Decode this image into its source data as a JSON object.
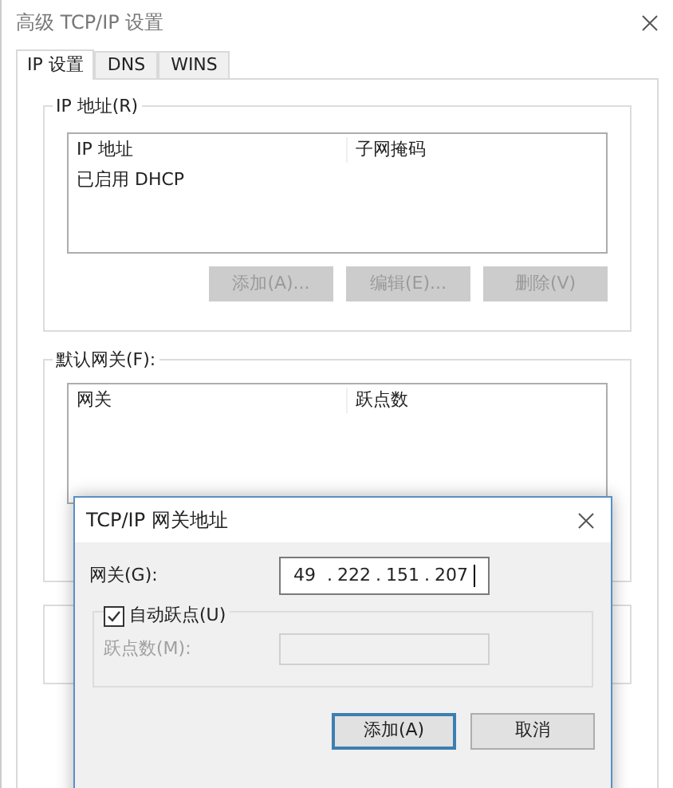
{
  "window": {
    "title": "高级 TCP/IP 设置"
  },
  "tabs": [
    {
      "label": "IP 设置",
      "selected": true
    },
    {
      "label": "DNS",
      "selected": false
    },
    {
      "label": "WINS",
      "selected": false
    }
  ],
  "ip_group": {
    "title": "IP 地址(R)",
    "columns": [
      "IP 地址",
      "子网掩码"
    ],
    "rows": [
      [
        "已启用 DHCP"
      ]
    ],
    "buttons": [
      {
        "label": "添加(A)...",
        "disabled": true
      },
      {
        "label": "编辑(E)...",
        "disabled": true
      },
      {
        "label": "删除(V)",
        "disabled": true
      }
    ]
  },
  "gateway_group": {
    "title": "默认网关(F):",
    "columns": [
      "网关",
      "跃点数"
    ]
  },
  "dialog": {
    "title": "TCP/IP 网关地址",
    "gateway_label": "网关(G):",
    "octets": [
      "49",
      "222",
      "151",
      "207"
    ],
    "separators": [
      ".",
      ".",
      "."
    ],
    "auto_metric": {
      "label": "自动跃点(U)",
      "checked": true
    },
    "metric": {
      "label": "跃点数(M):",
      "disabled": true
    },
    "buttons": [
      {
        "label": "添加(A)",
        "default": true
      },
      {
        "label": "取消",
        "default": false
      }
    ]
  }
}
